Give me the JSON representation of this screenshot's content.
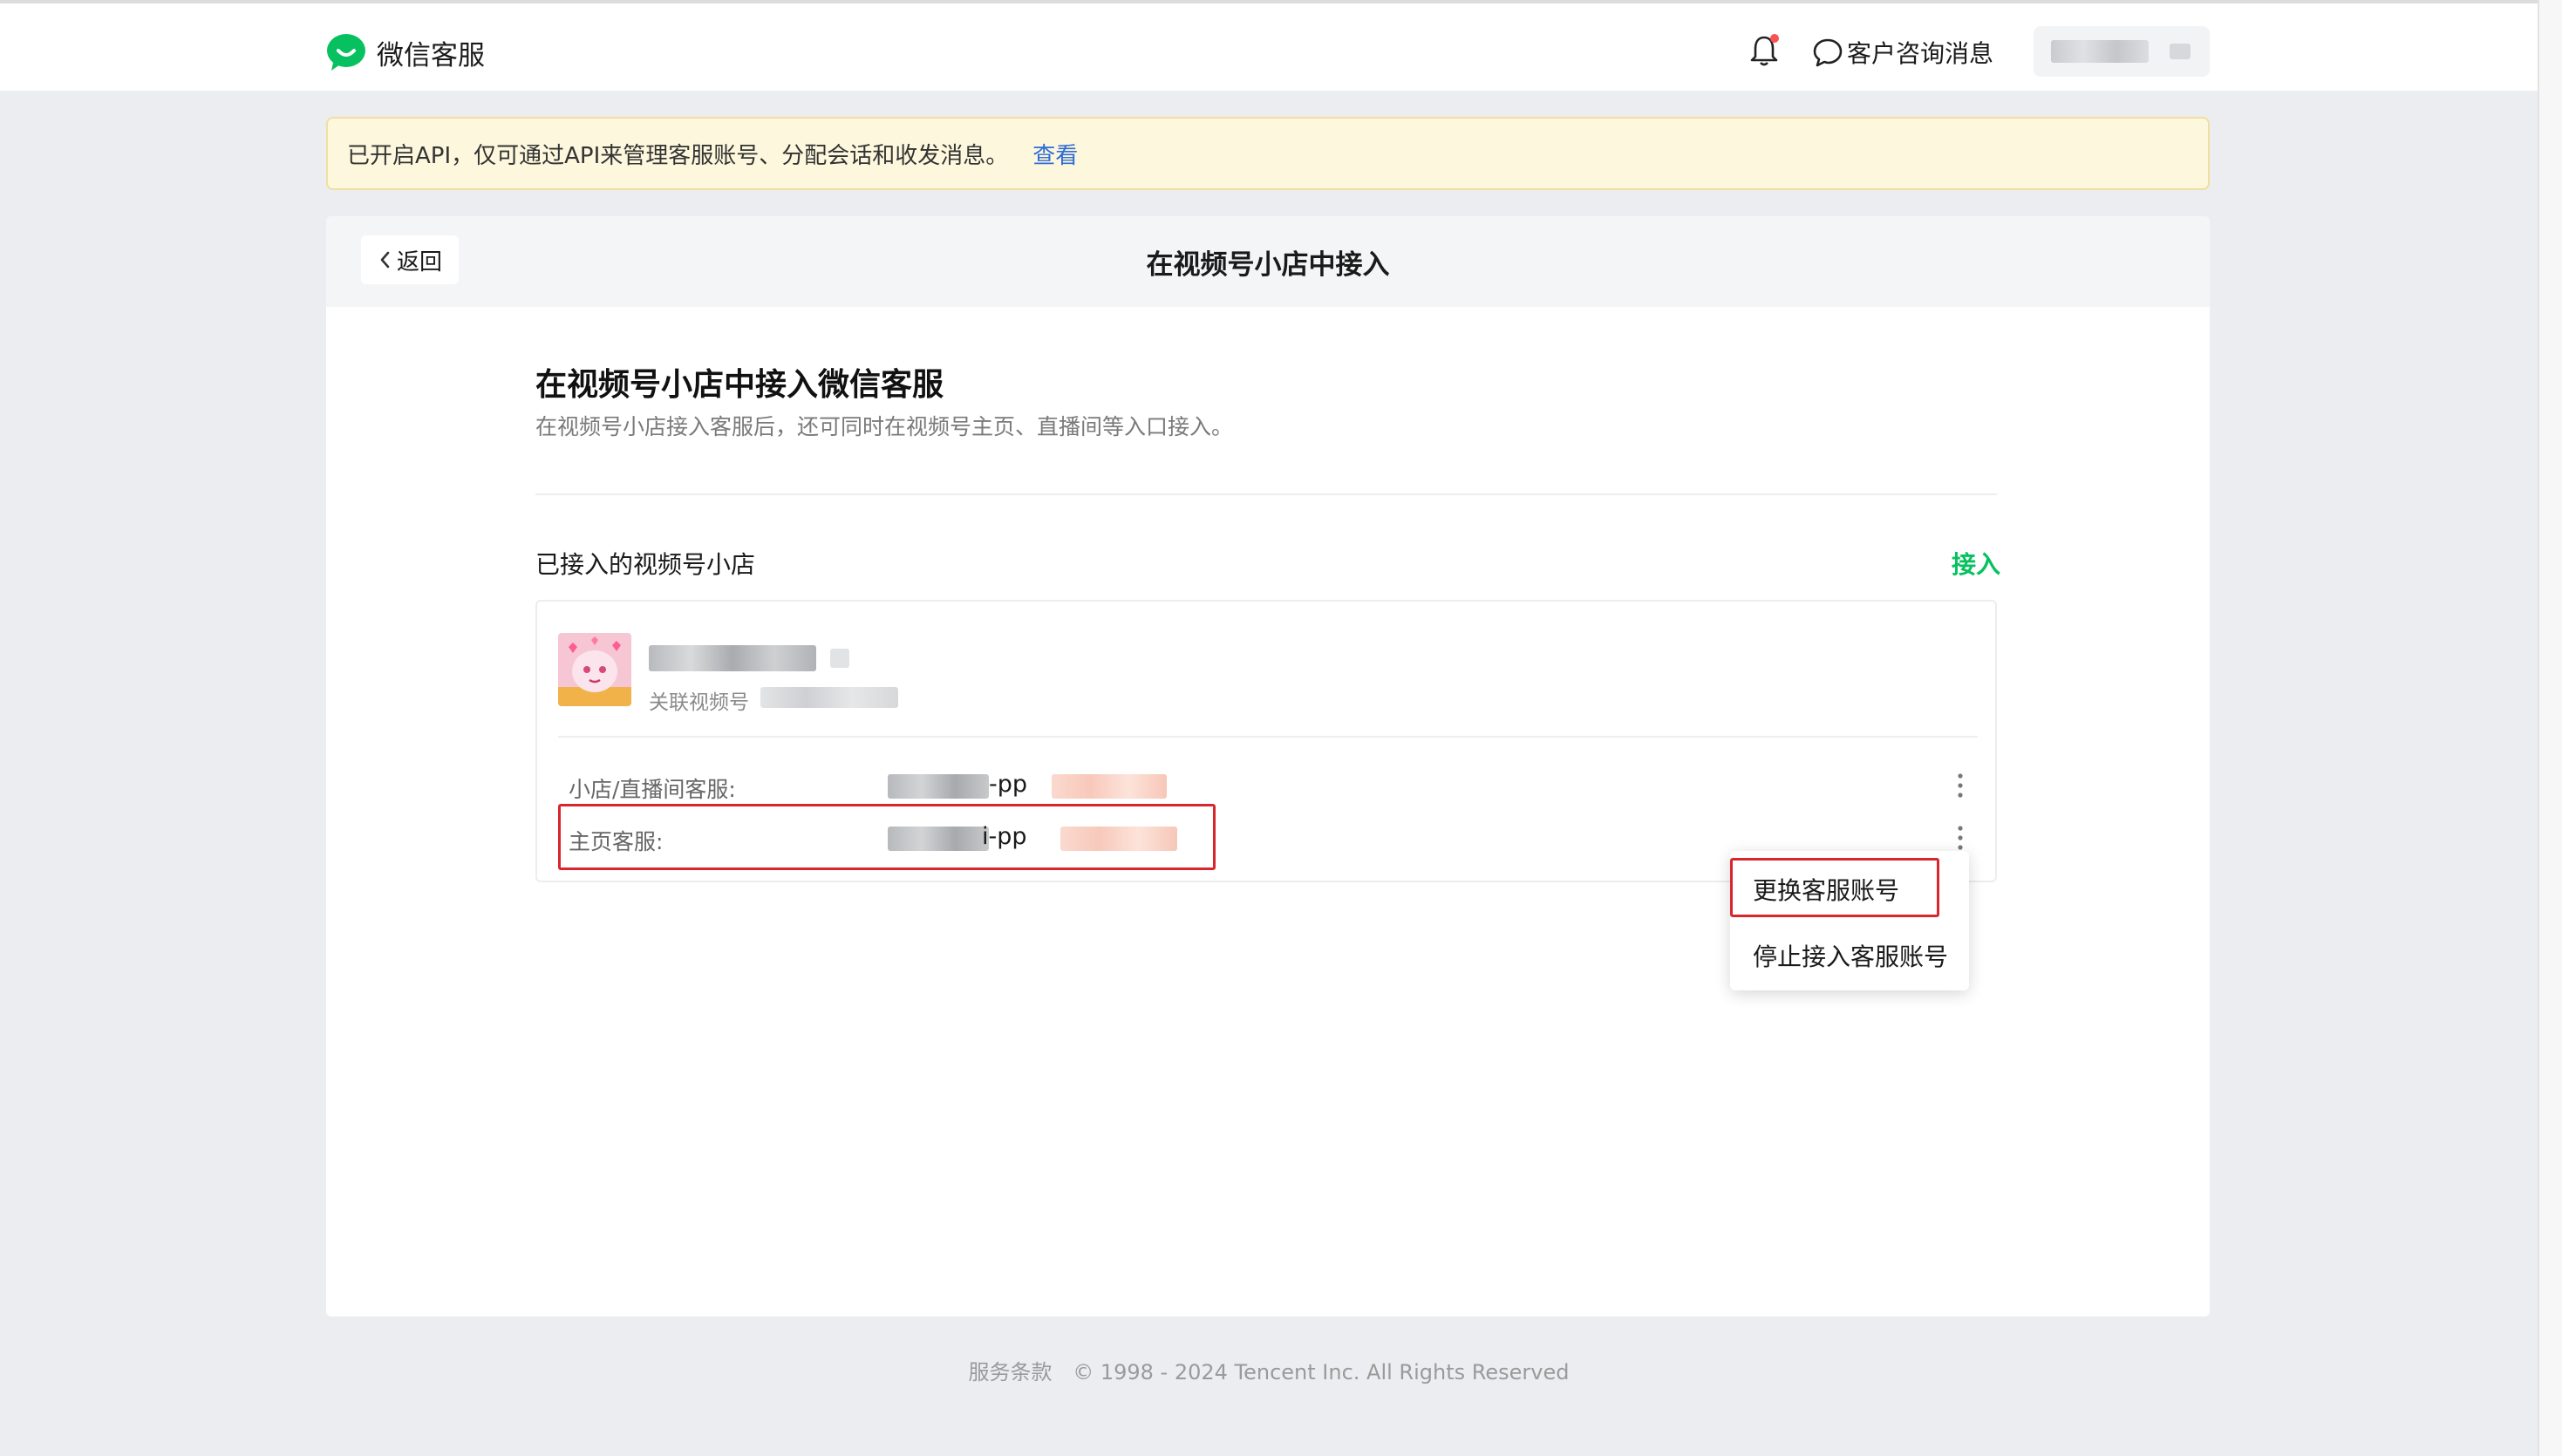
{
  "header": {
    "brand_name": "微信客服",
    "consult_label": "客户咨询消息",
    "icons": {
      "bell": "bell-icon",
      "chat": "chat-bubble-icon",
      "logo": "wechat-kefu-logo"
    },
    "accent_color": "#07c160"
  },
  "notice": {
    "text": "已开启API，仅可通过API来管理客服账号、分配会话和收发消息。",
    "link": "查看"
  },
  "card": {
    "back_label": "返回",
    "title": "在视频号小店中接入"
  },
  "section": {
    "title": "在视频号小店中接入微信客服",
    "description": "在视频号小店接入客服后，还可同时在视频号主页、直播间等入口接入。"
  },
  "shop_list": {
    "title": "已接入的视频号小店",
    "connect_label": "接入",
    "shop": {
      "assoc_label": "关联视频号",
      "rows": [
        {
          "label": "小店/直播间客服:",
          "value_suffix": "-pp"
        },
        {
          "label": "主页客服:",
          "value_suffix": "i-pp"
        }
      ]
    }
  },
  "dropdown": {
    "items": [
      "更换客服账号",
      "停止接入客服账号"
    ]
  },
  "footer": {
    "terms": "服务条款",
    "copyright": "© 1998 - 2024 Tencent Inc. All Rights Reserved"
  }
}
